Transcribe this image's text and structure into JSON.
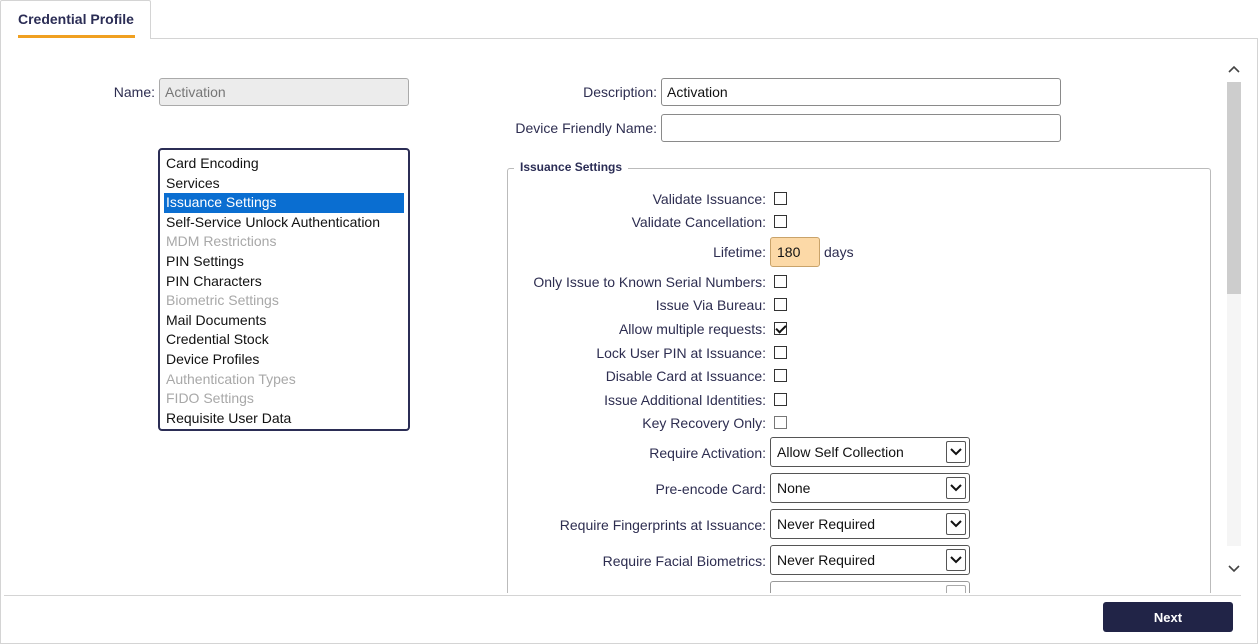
{
  "tab": {
    "label": "Credential Profile"
  },
  "name_field": {
    "label": "Name:",
    "value": "Activation"
  },
  "description_field": {
    "label": "Description:",
    "value": "Activation"
  },
  "device_friendly_name": {
    "label": "Device Friendly Name:",
    "value": ""
  },
  "sections": [
    {
      "label": "Card Encoding",
      "state": "enabled"
    },
    {
      "label": "Services",
      "state": "enabled"
    },
    {
      "label": "Issuance Settings",
      "state": "selected"
    },
    {
      "label": "Self-Service Unlock Authentication",
      "state": "enabled"
    },
    {
      "label": "MDM Restrictions",
      "state": "disabled"
    },
    {
      "label": "PIN Settings",
      "state": "enabled"
    },
    {
      "label": "PIN Characters",
      "state": "enabled"
    },
    {
      "label": "Biometric Settings",
      "state": "disabled"
    },
    {
      "label": "Mail Documents",
      "state": "enabled"
    },
    {
      "label": "Credential Stock",
      "state": "enabled"
    },
    {
      "label": "Device Profiles",
      "state": "enabled"
    },
    {
      "label": "Authentication Types",
      "state": "disabled"
    },
    {
      "label": "FIDO Settings",
      "state": "disabled"
    },
    {
      "label": "Requisite User Data",
      "state": "enabled"
    }
  ],
  "issuance": {
    "legend": "Issuance Settings",
    "validate_issuance": {
      "label": "Validate Issuance:",
      "checked": false
    },
    "validate_cancellation": {
      "label": "Validate Cancellation:",
      "checked": false
    },
    "lifetime": {
      "label": "Lifetime:",
      "value": "180",
      "unit": "days"
    },
    "only_known_serials": {
      "label": "Only Issue to Known Serial Numbers:",
      "checked": false
    },
    "issue_via_bureau": {
      "label": "Issue Via Bureau:",
      "checked": false
    },
    "allow_multiple_requests": {
      "label": "Allow multiple requests:",
      "checked": true
    },
    "lock_user_pin": {
      "label": "Lock User PIN at Issuance:",
      "checked": false
    },
    "disable_card": {
      "label": "Disable Card at Issuance:",
      "checked": false
    },
    "issue_additional_identities": {
      "label": "Issue Additional Identities:",
      "checked": false
    },
    "key_recovery_only": {
      "label": "Key Recovery Only:",
      "checked": false
    },
    "require_activation": {
      "label": "Require Activation:",
      "value": "Allow Self Collection"
    },
    "preencode_card": {
      "label": "Pre-encode Card:",
      "value": "None"
    },
    "require_fingerprints": {
      "label": "Require Fingerprints at Issuance:",
      "value": "Never Required"
    },
    "require_facial": {
      "label": "Require Facial Biometrics:",
      "value": "Never Required"
    }
  },
  "footer": {
    "next_label": "Next"
  }
}
